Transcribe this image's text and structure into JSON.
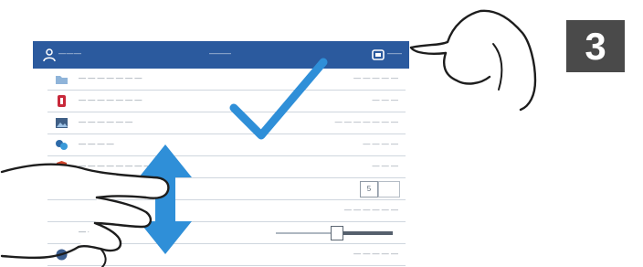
{
  "header": {
    "user_label": "———",
    "title": "———",
    "device_label": "——"
  },
  "rows": [
    {
      "label": "— — — — — — —",
      "value": "— — — — —"
    },
    {
      "label": "— — — — — — —",
      "value": "— — —"
    },
    {
      "label": "— — — — — —",
      "value": "— — — — — — —"
    },
    {
      "label": "— — — —",
      "value": "— — — —"
    },
    {
      "label": "— — — — — — — —",
      "value": "— — —"
    },
    {
      "label": "",
      "value": ""
    },
    {
      "label": "",
      "value": "— — — — — —"
    },
    {
      "label": "— — —",
      "value": ""
    },
    {
      "label": "",
      "value": "— — — — —"
    }
  ],
  "stepper": {
    "value": "5"
  },
  "slider": {
    "level": 0.6
  },
  "step_badge": "3",
  "colors": {
    "header": "#2b5a9e",
    "checkmark": "#2f8fd8",
    "arrow": "#2f8fd8",
    "badge": "#4a4a4a"
  },
  "icons": {
    "header_left": "user-icon",
    "header_right": "device-icon",
    "rows": [
      "folder-icon",
      "red-app-icon",
      "image-icon",
      "network-icon",
      "shield-icon"
    ]
  },
  "gestures": {
    "checkmark": "checkmark-icon",
    "swipe": "vertical-swipe-arrow-icon",
    "hands": [
      "tap-hand-icon",
      "swipe-hand-icon"
    ]
  }
}
